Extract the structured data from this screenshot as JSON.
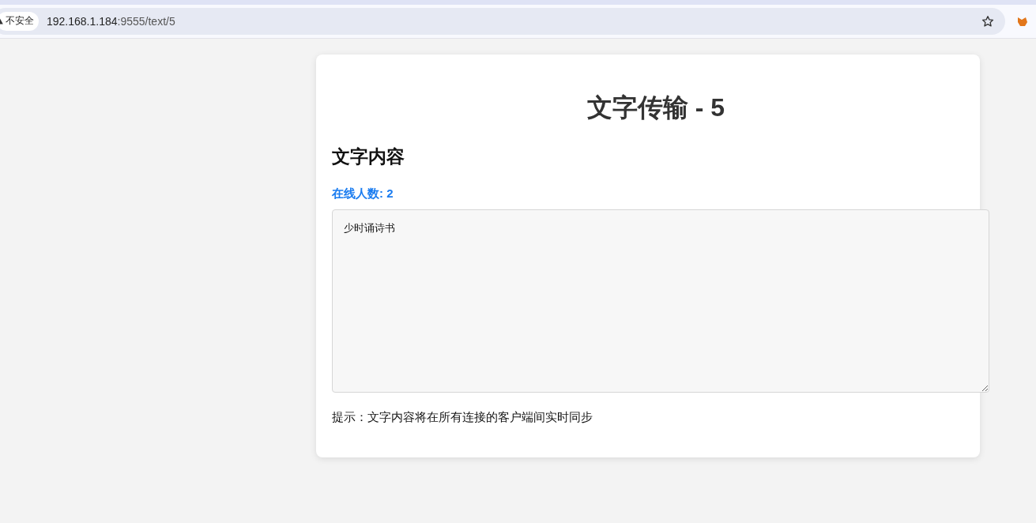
{
  "browser": {
    "security_label": "不安全",
    "url_host": "192.168.1.184",
    "url_path": ":9555/text/5"
  },
  "card": {
    "title": "文字传输 - 5",
    "section_heading": "文字内容",
    "online_count": "在线人数: 2",
    "text_value": "少时诵诗书",
    "hint": "提示：文字内容将在所有连接的客户端间实时同步"
  }
}
